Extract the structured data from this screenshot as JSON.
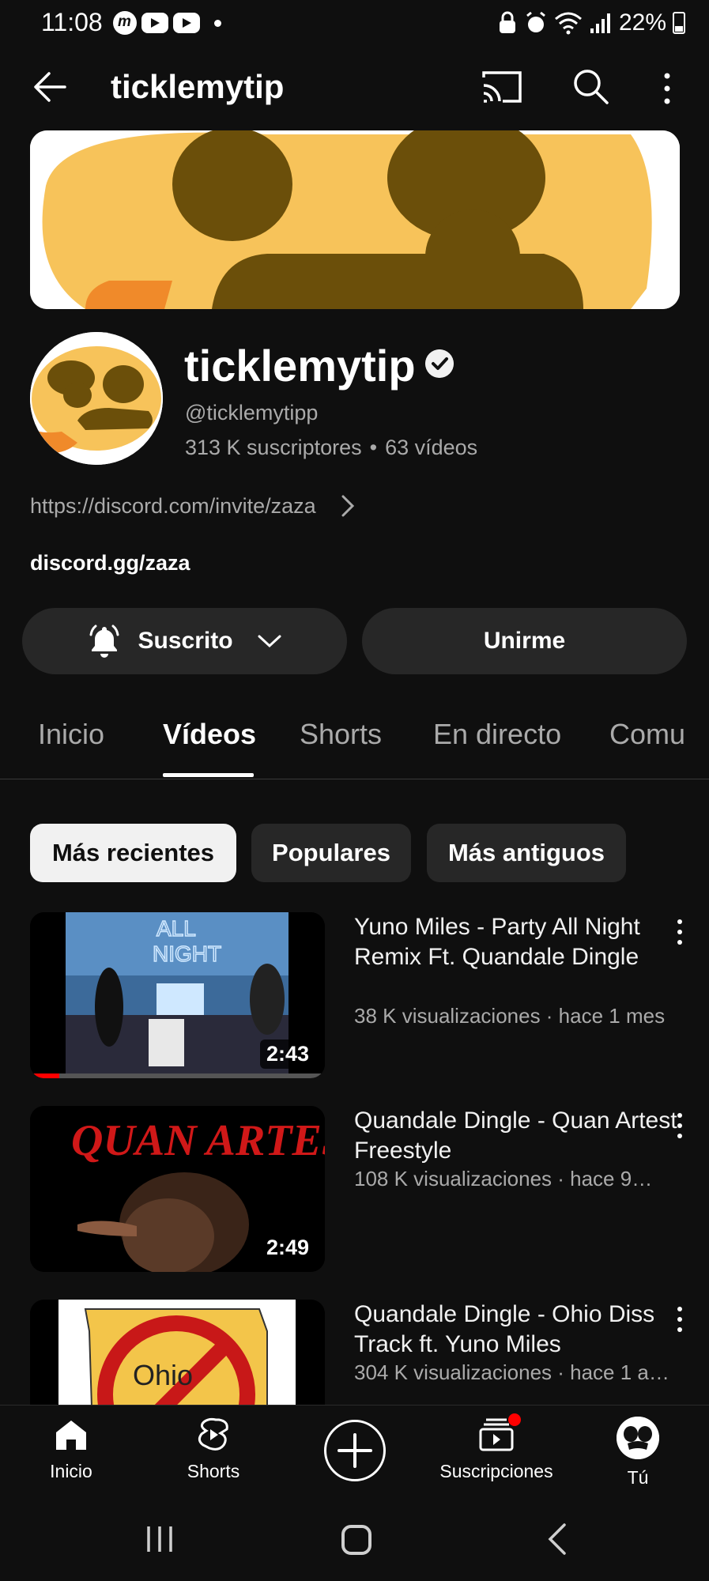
{
  "status_bar": {
    "time": "11:08",
    "battery": "22%"
  },
  "top_bar": {
    "title": "ticklemytip"
  },
  "channel": {
    "name": "ticklemytip",
    "handle": "@ticklemytipp",
    "subscribers": "313 K suscriptores",
    "videos_count": "63 vídeos",
    "stats_separator": "•",
    "link": "https://discord.com/invite/zaza",
    "description": "discord.gg/zaza"
  },
  "actions": {
    "subscribed_label": "Suscrito",
    "join_label": "Unirme"
  },
  "tabs": [
    {
      "label": "Inicio",
      "active": false
    },
    {
      "label": "Vídeos",
      "active": true
    },
    {
      "label": "Shorts",
      "active": false
    },
    {
      "label": "En directo",
      "active": false
    },
    {
      "label": "Comu",
      "active": false
    }
  ],
  "chips": [
    {
      "label": "Más recientes",
      "active": true
    },
    {
      "label": "Populares",
      "active": false
    },
    {
      "label": "Más antiguos",
      "active": false
    }
  ],
  "videos": [
    {
      "title": "Yuno Miles - Party All Night Remix Ft. Quandale Dingle",
      "meta": "38 K visualizaciones · hace 1 mes",
      "duration": "2:43",
      "watched_fraction": 0.1,
      "thumb_text": "ALL NIGHT"
    },
    {
      "title": "Quandale Dingle - Quan Artest Freestyle",
      "meta": "108 K visualizaciones · hace 9…",
      "duration": "2:49",
      "thumb_text": "QUAN ARTEST"
    },
    {
      "title": "Quandale Dingle - Ohio Diss Track ft. Yuno Miles",
      "meta": "304 K visualizaciones · hace 1 a…",
      "thumb_text": "Ohio"
    }
  ],
  "bottom_nav": [
    {
      "label": "Inicio",
      "icon": "home-icon"
    },
    {
      "label": "Shorts",
      "icon": "shorts-icon"
    },
    {
      "label": "",
      "icon": "create-icon"
    },
    {
      "label": "Suscripciones",
      "icon": "subscriptions-icon"
    },
    {
      "label": "Tú",
      "icon": "avatar"
    }
  ],
  "colors": {
    "background": "#0f0f0f",
    "surface": "#272727",
    "accent": "#ff0000",
    "secondary_text": "#aaaaaa"
  }
}
